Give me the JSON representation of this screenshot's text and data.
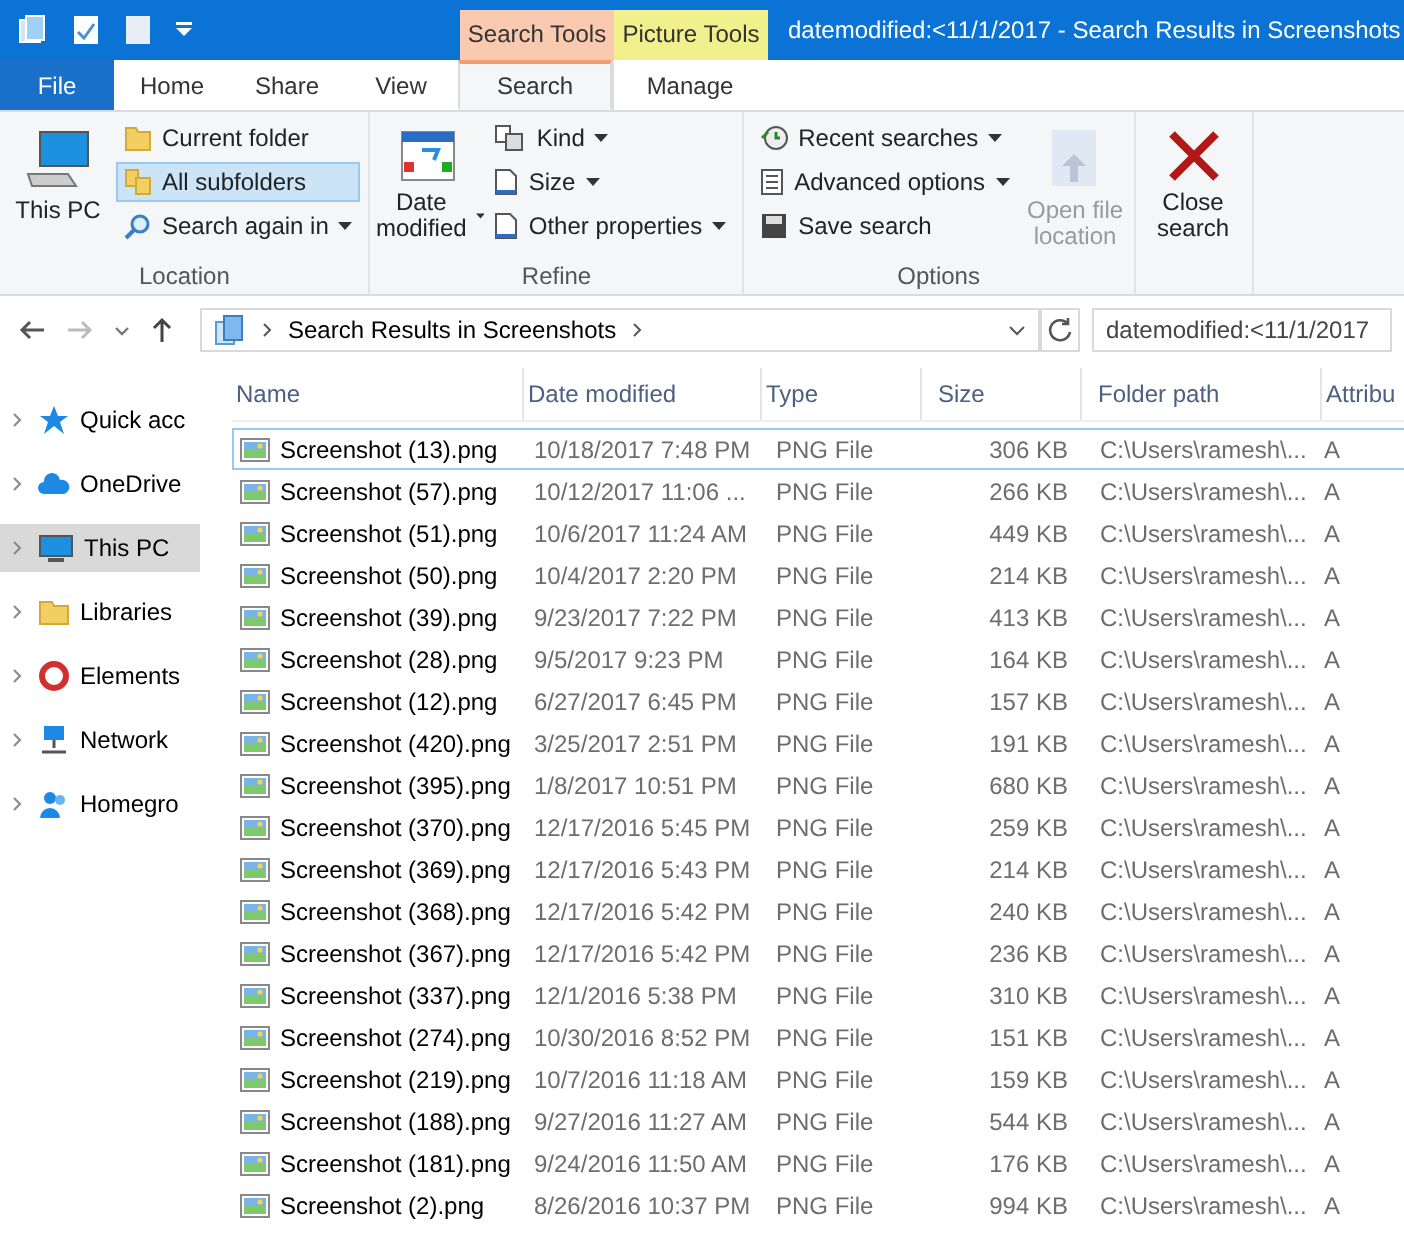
{
  "window": {
    "title": "datemodified:<11/1/2017 - Search Results in Screenshots"
  },
  "context_tabs": [
    {
      "label": "Search Tools",
      "color": "#f9c9b0"
    },
    {
      "label": "Picture Tools",
      "color": "#f0f08c"
    }
  ],
  "ribbon_tabs": [
    {
      "label": "File",
      "kind": "file",
      "selected": false
    },
    {
      "label": "Home",
      "kind": "plain",
      "selected": false
    },
    {
      "label": "Share",
      "kind": "plain",
      "selected": false
    },
    {
      "label": "View",
      "kind": "plain",
      "selected": false
    },
    {
      "label": "Search",
      "kind": "context",
      "selected": true
    },
    {
      "label": "Manage",
      "kind": "context",
      "selected": false
    }
  ],
  "ribbon": {
    "location": {
      "label": "Location",
      "this_pc": "This PC",
      "items": [
        {
          "label": "Current folder",
          "selected": false,
          "dropdown": false
        },
        {
          "label": "All subfolders",
          "selected": true,
          "dropdown": false
        },
        {
          "label": "Search again in",
          "selected": false,
          "dropdown": true
        }
      ]
    },
    "refine": {
      "label": "Refine",
      "date_modified": "Date modified",
      "items": [
        {
          "label": "Kind"
        },
        {
          "label": "Size"
        },
        {
          "label": "Other properties"
        }
      ]
    },
    "options": {
      "label": "Options",
      "items": [
        {
          "label": "Recent searches",
          "dropdown": true
        },
        {
          "label": "Advanced options",
          "dropdown": true
        },
        {
          "label": "Save search",
          "dropdown": false
        }
      ],
      "open_location": {
        "label": "Open file location",
        "disabled": true
      }
    },
    "close": {
      "label": "Close search"
    }
  },
  "address": {
    "path": "Search Results in Screenshots",
    "search_value": "datemodified:<11/1/2017"
  },
  "sidebar": {
    "items": [
      {
        "label": "Quick acc",
        "selected": false
      },
      {
        "label": "OneDrive",
        "selected": false
      },
      {
        "label": "This PC",
        "selected": true
      },
      {
        "label": "Libraries",
        "selected": false
      },
      {
        "label": "Elements",
        "selected": false
      },
      {
        "label": "Network",
        "selected": false
      },
      {
        "label": "Homegro",
        "selected": false
      }
    ]
  },
  "table": {
    "columns": [
      "Name",
      "Date modified",
      "Type",
      "Size",
      "Folder path",
      "Attribu"
    ],
    "rows": [
      {
        "cells": [
          "Screenshot (13).png",
          "10/18/2017 7:48 PM",
          "PNG File",
          "306 KB",
          "C:\\Users\\ramesh\\...",
          "A"
        ],
        "focused": true
      },
      {
        "cells": [
          "Screenshot (57).png",
          "10/12/2017 11:06 ...",
          "PNG File",
          "266 KB",
          "C:\\Users\\ramesh\\...",
          "A"
        ],
        "focused": false
      },
      {
        "cells": [
          "Screenshot (51).png",
          "10/6/2017 11:24 AM",
          "PNG File",
          "449 KB",
          "C:\\Users\\ramesh\\...",
          "A"
        ],
        "focused": false
      },
      {
        "cells": [
          "Screenshot (50).png",
          "10/4/2017 2:20 PM",
          "PNG File",
          "214 KB",
          "C:\\Users\\ramesh\\...",
          "A"
        ],
        "focused": false
      },
      {
        "cells": [
          "Screenshot (39).png",
          "9/23/2017 7:22 PM",
          "PNG File",
          "413 KB",
          "C:\\Users\\ramesh\\...",
          "A"
        ],
        "focused": false
      },
      {
        "cells": [
          "Screenshot (28).png",
          "9/5/2017 9:23 PM",
          "PNG File",
          "164 KB",
          "C:\\Users\\ramesh\\...",
          "A"
        ],
        "focused": false
      },
      {
        "cells": [
          "Screenshot (12).png",
          "6/27/2017 6:45 PM",
          "PNG File",
          "157 KB",
          "C:\\Users\\ramesh\\...",
          "A"
        ],
        "focused": false
      },
      {
        "cells": [
          "Screenshot (420).png",
          "3/25/2017 2:51 PM",
          "PNG File",
          "191 KB",
          "C:\\Users\\ramesh\\...",
          "A"
        ],
        "focused": false
      },
      {
        "cells": [
          "Screenshot (395).png",
          "1/8/2017 10:51 PM",
          "PNG File",
          "680 KB",
          "C:\\Users\\ramesh\\...",
          "A"
        ],
        "focused": false
      },
      {
        "cells": [
          "Screenshot (370).png",
          "12/17/2016 5:45 PM",
          "PNG File",
          "259 KB",
          "C:\\Users\\ramesh\\...",
          "A"
        ],
        "focused": false
      },
      {
        "cells": [
          "Screenshot (369).png",
          "12/17/2016 5:43 PM",
          "PNG File",
          "214 KB",
          "C:\\Users\\ramesh\\...",
          "A"
        ],
        "focused": false
      },
      {
        "cells": [
          "Screenshot (368).png",
          "12/17/2016 5:42 PM",
          "PNG File",
          "240 KB",
          "C:\\Users\\ramesh\\...",
          "A"
        ],
        "focused": false
      },
      {
        "cells": [
          "Screenshot (367).png",
          "12/17/2016 5:42 PM",
          "PNG File",
          "236 KB",
          "C:\\Users\\ramesh\\...",
          "A"
        ],
        "focused": false
      },
      {
        "cells": [
          "Screenshot (337).png",
          "12/1/2016 5:38 PM",
          "PNG File",
          "310 KB",
          "C:\\Users\\ramesh\\...",
          "A"
        ],
        "focused": false
      },
      {
        "cells": [
          "Screenshot (274).png",
          "10/30/2016 8:52 PM",
          "PNG File",
          "151 KB",
          "C:\\Users\\ramesh\\...",
          "A"
        ],
        "focused": false
      },
      {
        "cells": [
          "Screenshot (219).png",
          "10/7/2016 11:18 AM",
          "PNG File",
          "159 KB",
          "C:\\Users\\ramesh\\...",
          "A"
        ],
        "focused": false
      },
      {
        "cells": [
          "Screenshot (188).png",
          "9/27/2016 11:27 AM",
          "PNG File",
          "544 KB",
          "C:\\Users\\ramesh\\...",
          "A"
        ],
        "focused": false
      },
      {
        "cells": [
          "Screenshot (181).png",
          "9/24/2016 11:50 AM",
          "PNG File",
          "176 KB",
          "C:\\Users\\ramesh\\...",
          "A"
        ],
        "focused": false
      },
      {
        "cells": [
          "Screenshot (2).png",
          "8/26/2016 10:37 PM",
          "PNG File",
          "994 KB",
          "C:\\Users\\ramesh\\...",
          "A"
        ],
        "focused": false
      }
    ]
  }
}
